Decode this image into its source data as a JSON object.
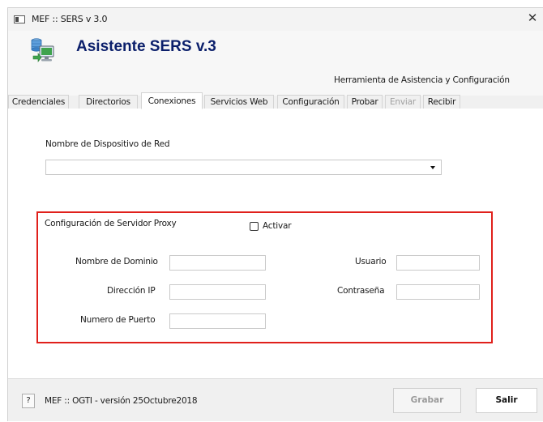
{
  "window": {
    "title": "MEF :: SERS v 3.0",
    "close_glyph": "✕"
  },
  "header": {
    "app_title": "Asistente SERS v.3",
    "subtitle": "Herramienta de Asistencia y Configuración",
    "logo_icon": "network-computer-icon"
  },
  "tabs": [
    {
      "label": "Credenciales",
      "state": "normal"
    },
    {
      "label": "Directorios",
      "state": "normal"
    },
    {
      "label": "Conexiones",
      "state": "active"
    },
    {
      "label": "Servicios Web",
      "state": "normal"
    },
    {
      "label": "Configuración",
      "state": "normal"
    },
    {
      "label": "Probar",
      "state": "normal"
    },
    {
      "label": "Enviar",
      "state": "disabled"
    },
    {
      "label": "Recibir",
      "state": "normal"
    }
  ],
  "conexiones": {
    "device_label": "Nombre de Dispositivo de Red",
    "device_value": "",
    "proxy": {
      "title": "Configuración de Servidor Proxy",
      "activar_label": "Activar",
      "activar_checked": false,
      "domain_label": "Nombre de Dominio",
      "domain_value": "",
      "ip_label": "Dirección IP",
      "ip_value": "",
      "port_label": "Numero de Puerto",
      "port_value": "",
      "user_label": "Usuario",
      "user_value": "",
      "password_label": "Contraseña",
      "password_value": ""
    }
  },
  "footer": {
    "help_label": "?",
    "version_text": "MEF :: OGTI - versión 25Octubre2018",
    "save_label": "Grabar",
    "save_enabled": false,
    "exit_label": "Salir"
  },
  "colors": {
    "title_blue": "#0b1f6b",
    "highlight_red": "#e0201b",
    "disabled_text": "#a0a0a0"
  }
}
